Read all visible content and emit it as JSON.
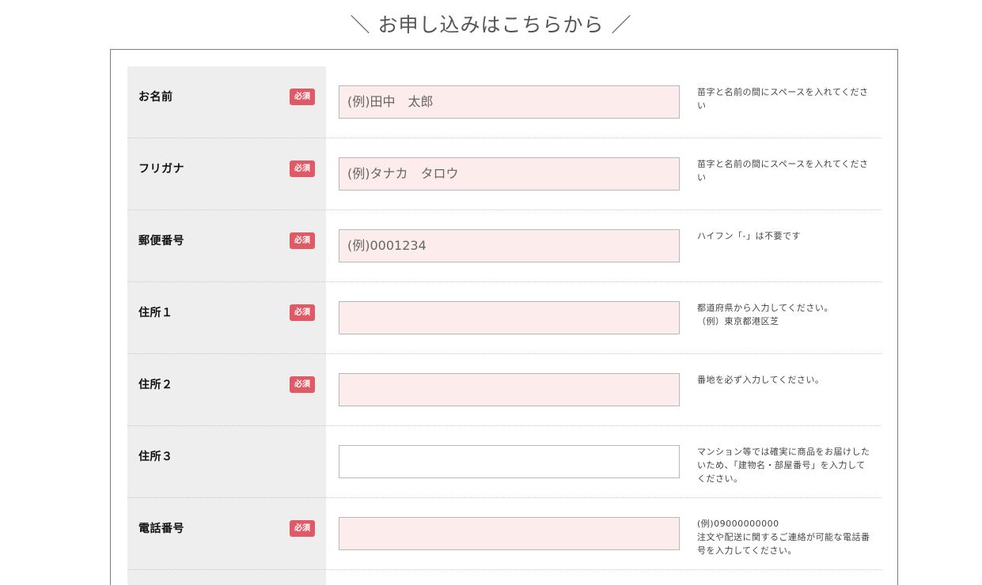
{
  "heading": "＼ お申し込みはこちらから ／",
  "form": {
    "required_label": "必須",
    "rows": [
      {
        "label": "お名前",
        "required": true,
        "placeholder": "(例)田中　太郎",
        "hint": "苗字と名前の間にスペースを入れてください"
      },
      {
        "label": "フリガナ",
        "required": true,
        "placeholder": "(例)タナカ　タロウ",
        "hint": "苗字と名前の間にスペースを入れてください"
      },
      {
        "label": "郵便番号",
        "required": true,
        "placeholder": "(例)0001234",
        "hint": "ハイフン「-」は不要です"
      },
      {
        "label": "住所１",
        "required": true,
        "placeholder": "",
        "hint": "都道府県から入力してください。\n（例）東京都港区芝"
      },
      {
        "label": "住所２",
        "required": true,
        "placeholder": "",
        "hint": "番地を必ず入力してください。"
      },
      {
        "label": "住所３",
        "required": false,
        "placeholder": "",
        "hint": "マンション等では確実に商品をお届けしたいため、「建物名・部屋番号」を入力してください。"
      },
      {
        "label": "電話番号",
        "required": true,
        "placeholder": "",
        "hint": "(例)09000000000\n注文や配送に関するご連絡が可能な電話番号を入力してください。"
      }
    ]
  },
  "colors": {
    "required_badge": "#e05a66",
    "input_required_bg": "#fdecec",
    "label_column_bg": "#eeeeee"
  }
}
